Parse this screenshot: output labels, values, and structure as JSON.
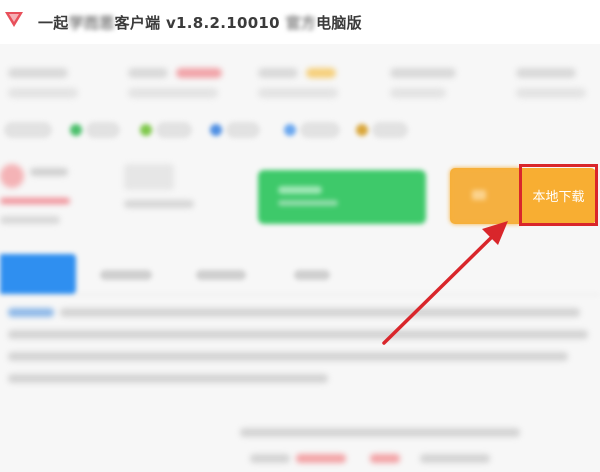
{
  "window": {
    "title_prefix": "一起",
    "title_suffix": "客户端 v1.8.2.10010",
    "title_tail": "电脑版"
  },
  "actions": {
    "local_download_label": "本地下载"
  },
  "colors": {
    "green_button": "#3ec96a",
    "orange_button": "#f8ae32",
    "tab_active": "#2f8ff0",
    "highlight_box": "#d9262b",
    "arrow": "#d9262b"
  },
  "icons": {
    "app_logo": "red-triangle-logo-icon",
    "annotation_arrow": "red-arrow-icon"
  }
}
